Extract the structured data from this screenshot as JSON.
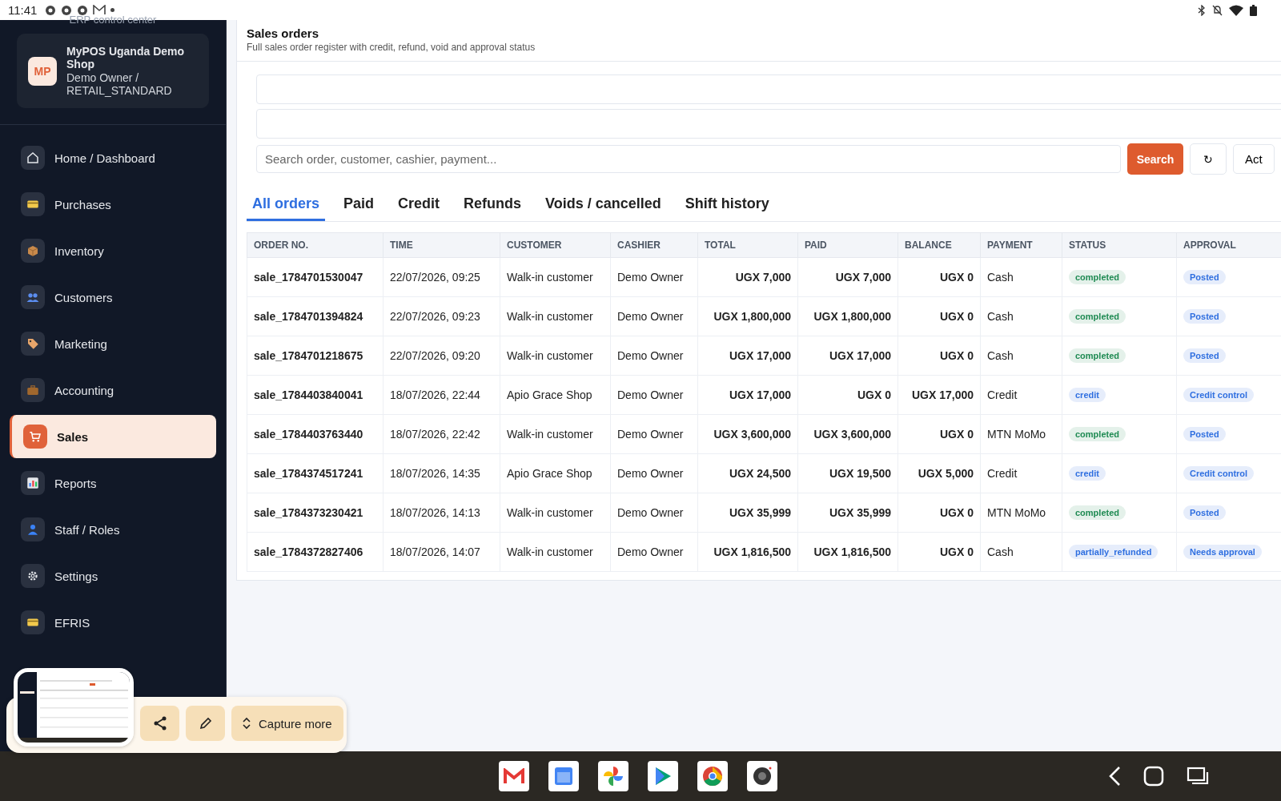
{
  "status_bar": {
    "time": "11:41"
  },
  "sidebar": {
    "subtitle": "ERP control center",
    "shop": {
      "initials": "MP",
      "name": "MyPOS Uganda Demo Shop",
      "user": "Demo Owner / RETAIL_STANDARD"
    },
    "items": [
      {
        "label": "Home / Dashboard",
        "selected": false
      },
      {
        "label": "Purchases",
        "selected": false
      },
      {
        "label": "Inventory",
        "selected": false
      },
      {
        "label": "Customers",
        "selected": false
      },
      {
        "label": "Marketing",
        "selected": false
      },
      {
        "label": "Accounting",
        "selected": false
      },
      {
        "label": "Sales",
        "selected": true
      },
      {
        "label": "Reports",
        "selected": false
      },
      {
        "label": "Staff / Roles",
        "selected": false
      },
      {
        "label": "Settings",
        "selected": false
      },
      {
        "label": "EFRIS",
        "selected": false
      }
    ]
  },
  "page": {
    "title": "Sales orders",
    "subtitle": "Full sales order register with credit, refund, void and approval status"
  },
  "filters": {
    "search_placeholder": "Search order, customer, cashier, payment...",
    "search_button": "Search",
    "refresh_button": "↻",
    "actions_button": "Act"
  },
  "tabs": [
    {
      "label": "All orders",
      "selected": true
    },
    {
      "label": "Paid",
      "selected": false
    },
    {
      "label": "Credit",
      "selected": false
    },
    {
      "label": "Refunds",
      "selected": false
    },
    {
      "label": "Voids / cancelled",
      "selected": false
    },
    {
      "label": "Shift history",
      "selected": false
    }
  ],
  "table": {
    "columns": [
      "ORDER NO.",
      "TIME",
      "CUSTOMER",
      "CASHIER",
      "TOTAL",
      "PAID",
      "BALANCE",
      "PAYMENT",
      "STATUS",
      "APPROVAL"
    ],
    "rows": [
      {
        "order": "sale_1784701530047",
        "time": "22/07/2026, 09:25",
        "customer": "Walk-in customer",
        "cashier": "Demo Owner",
        "total": "UGX 7,000",
        "paid": "UGX 7,000",
        "balance": "UGX 0",
        "payment": "Cash",
        "status": {
          "text": "completed",
          "color": "#1e8a52"
        },
        "approval": "Posted"
      },
      {
        "order": "sale_1784701394824",
        "time": "22/07/2026, 09:23",
        "customer": "Walk-in customer",
        "cashier": "Demo Owner",
        "total": "UGX 1,800,000",
        "paid": "UGX 1,800,000",
        "balance": "UGX 0",
        "payment": "Cash",
        "status": {
          "text": "completed",
          "color": "#1e8a52"
        },
        "approval": "Posted"
      },
      {
        "order": "sale_1784701218675",
        "time": "22/07/2026, 09:20",
        "customer": "Walk-in customer",
        "cashier": "Demo Owner",
        "total": "UGX 17,000",
        "paid": "UGX 17,000",
        "balance": "UGX 0",
        "payment": "Cash",
        "status": {
          "text": "completed",
          "color": "#1e8a52"
        },
        "approval": "Posted"
      },
      {
        "order": "sale_1784403840041",
        "time": "18/07/2026, 22:44",
        "customer": "Apio Grace Shop",
        "cashier": "Demo Owner",
        "total": "UGX 17,000",
        "paid": "UGX 0",
        "balance": "UGX 17,000",
        "payment": "Credit",
        "status": {
          "text": "credit",
          "color": "#2f6fe0"
        },
        "approval": "Credit control"
      },
      {
        "order": "sale_1784403763440",
        "time": "18/07/2026, 22:42",
        "customer": "Walk-in customer",
        "cashier": "Demo Owner",
        "total": "UGX 3,600,000",
        "paid": "UGX 3,600,000",
        "balance": "UGX 0",
        "payment": "MTN MoMo",
        "status": {
          "text": "completed",
          "color": "#1e8a52"
        },
        "approval": "Posted"
      },
      {
        "order": "sale_1784374517241",
        "time": "18/07/2026, 14:35",
        "customer": "Apio Grace Shop",
        "cashier": "Demo Owner",
        "total": "UGX 24,500",
        "paid": "UGX 19,500",
        "balance": "UGX 5,000",
        "payment": "Credit",
        "status": {
          "text": "credit",
          "color": "#2f6fe0"
        },
        "approval": "Credit control"
      },
      {
        "order": "sale_1784373230421",
        "time": "18/07/2026, 14:13",
        "customer": "Walk-in customer",
        "cashier": "Demo Owner",
        "total": "UGX 35,999",
        "paid": "UGX 35,999",
        "balance": "UGX 0",
        "payment": "MTN MoMo",
        "status": {
          "text": "completed",
          "color": "#1e8a52"
        },
        "approval": "Posted"
      },
      {
        "order": "sale_1784372827406",
        "time": "18/07/2026, 14:07",
        "customer": "Walk-in customer",
        "cashier": "Demo Owner",
        "total": "UGX 1,816,500",
        "paid": "UGX 1,816,500",
        "balance": "UGX 0",
        "payment": "Cash",
        "status": {
          "text": "partially_refunded",
          "color": "#2f6fe0"
        },
        "approval": "Needs approval"
      }
    ]
  },
  "screenshot_toolbar": {
    "capture_more": "Capture more"
  }
}
